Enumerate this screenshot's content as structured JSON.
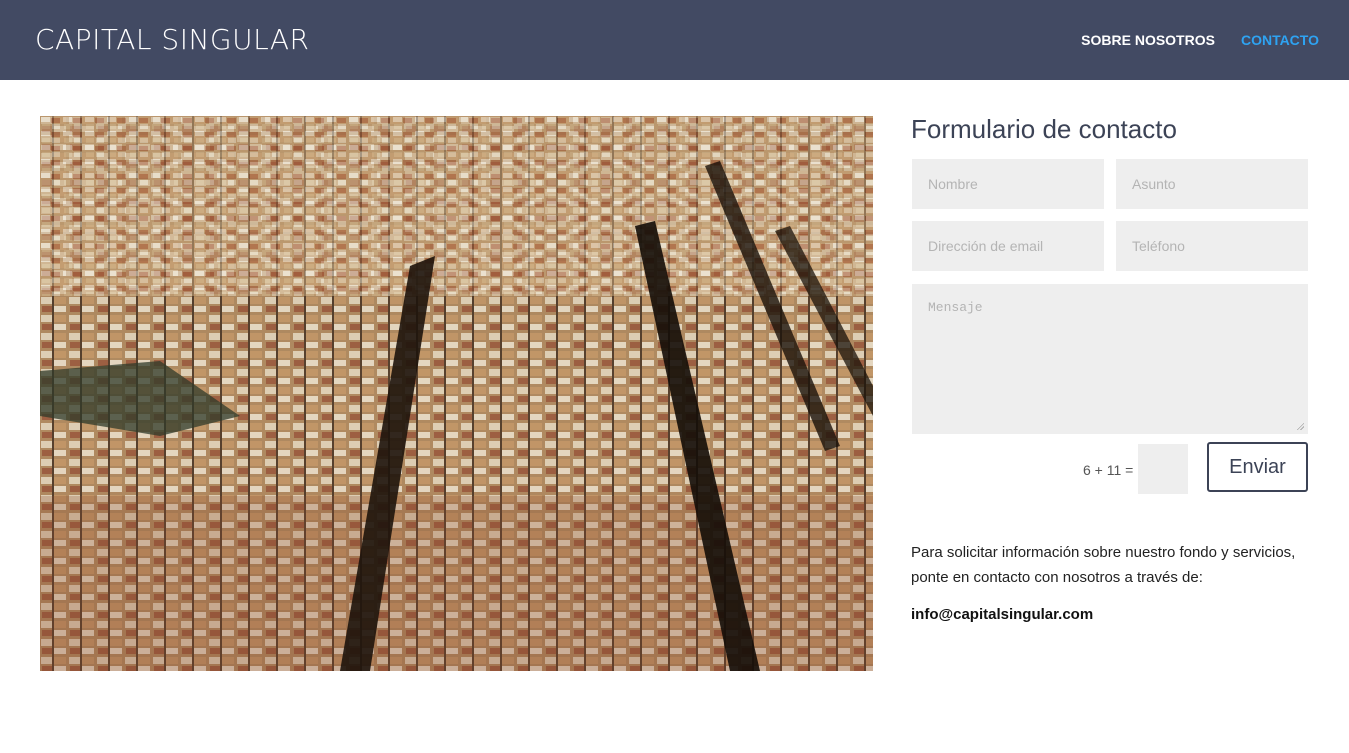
{
  "header": {
    "logo": "CAPITAL SINGULAR",
    "nav": [
      {
        "label": "SOBRE NOSOTROS",
        "active": false
      },
      {
        "label": "CONTACTO",
        "active": true
      }
    ],
    "background_color": "#424a63",
    "active_color": "#2ea3f2"
  },
  "hero_image": {
    "icon": "aerial-city-photo"
  },
  "form": {
    "title": "Formulario de contacto",
    "fields": {
      "nombre": {
        "placeholder": "Nombre",
        "value": ""
      },
      "asunto": {
        "placeholder": "Asunto",
        "value": ""
      },
      "email": {
        "placeholder": "Dirección de email",
        "value": ""
      },
      "telefono": {
        "placeholder": "Teléfono",
        "value": ""
      },
      "mensaje": {
        "placeholder": "Mensaje",
        "value": ""
      }
    },
    "captcha": {
      "question": "6 + 11 =",
      "value": ""
    },
    "submit_label": "Enviar"
  },
  "info": {
    "text": "Para solicitar información sobre nuestro fondo y servicios, ponte en contacto con nosotros a través de:",
    "email": "info@capitalsingular.com"
  }
}
